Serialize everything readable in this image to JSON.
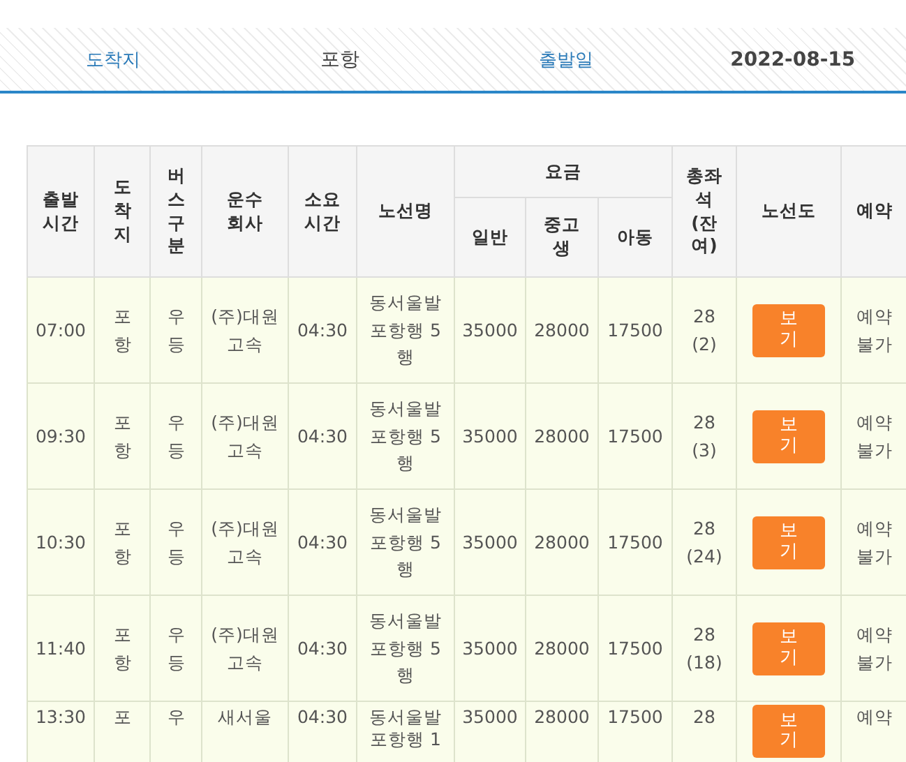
{
  "summary": [
    {
      "label": "도착지",
      "value": "포항"
    },
    {
      "label": "출발일",
      "value": "2022-08-15"
    }
  ],
  "table": {
    "columns": [
      "출발시간",
      "도착지",
      "버스구분",
      "운수회사",
      "소요시간",
      "노선명",
      "요금",
      "총좌석(잔여)",
      "노선도",
      "예약"
    ],
    "fare_columns": [
      "일반",
      "중고생",
      "아동"
    ],
    "rows": [
      {
        "departure": "07:00",
        "destination": "포항",
        "bus_type": "우등",
        "company": "(주)대원 고속",
        "duration": "04:30",
        "route": "동서울발 포항행 5행",
        "fares": [
          "35000",
          "28000",
          "17500"
        ],
        "seats": "28 (2)",
        "map_button": "보기",
        "reservation": "예약불가"
      },
      {
        "departure": "09:30",
        "destination": "포항",
        "bus_type": "우등",
        "company": "(주)대원 고속",
        "duration": "04:30",
        "route": "동서울발 포항행 5행",
        "fares": [
          "35000",
          "28000",
          "17500"
        ],
        "seats": "28 (3)",
        "map_button": "보기",
        "reservation": "예약불가"
      },
      {
        "departure": "10:30",
        "destination": "포항",
        "bus_type": "우등",
        "company": "(주)대원 고속",
        "duration": "04:30",
        "route": "동서울발 포항행 5행",
        "fares": [
          "35000",
          "28000",
          "17500"
        ],
        "seats": "28 (24)",
        "map_button": "보기",
        "reservation": "예약불가"
      },
      {
        "departure": "11:40",
        "destination": "포항",
        "bus_type": "우등",
        "company": "(주)대원 고속",
        "duration": "04:30",
        "route": "동서울발 포항행 5행",
        "fares": [
          "35000",
          "28000",
          "17500"
        ],
        "seats": "28 (18)",
        "map_button": "보기",
        "reservation": "예약불가"
      },
      {
        "departure": "13:30",
        "destination": "포",
        "bus_type": "우",
        "company": "새서울",
        "duration": "04:30",
        "route": "동서울발 포항행 1",
        "fares": [
          "35000",
          "28000",
          "17500"
        ],
        "seats": "28",
        "map_button": "보기",
        "reservation": "예약"
      }
    ]
  }
}
